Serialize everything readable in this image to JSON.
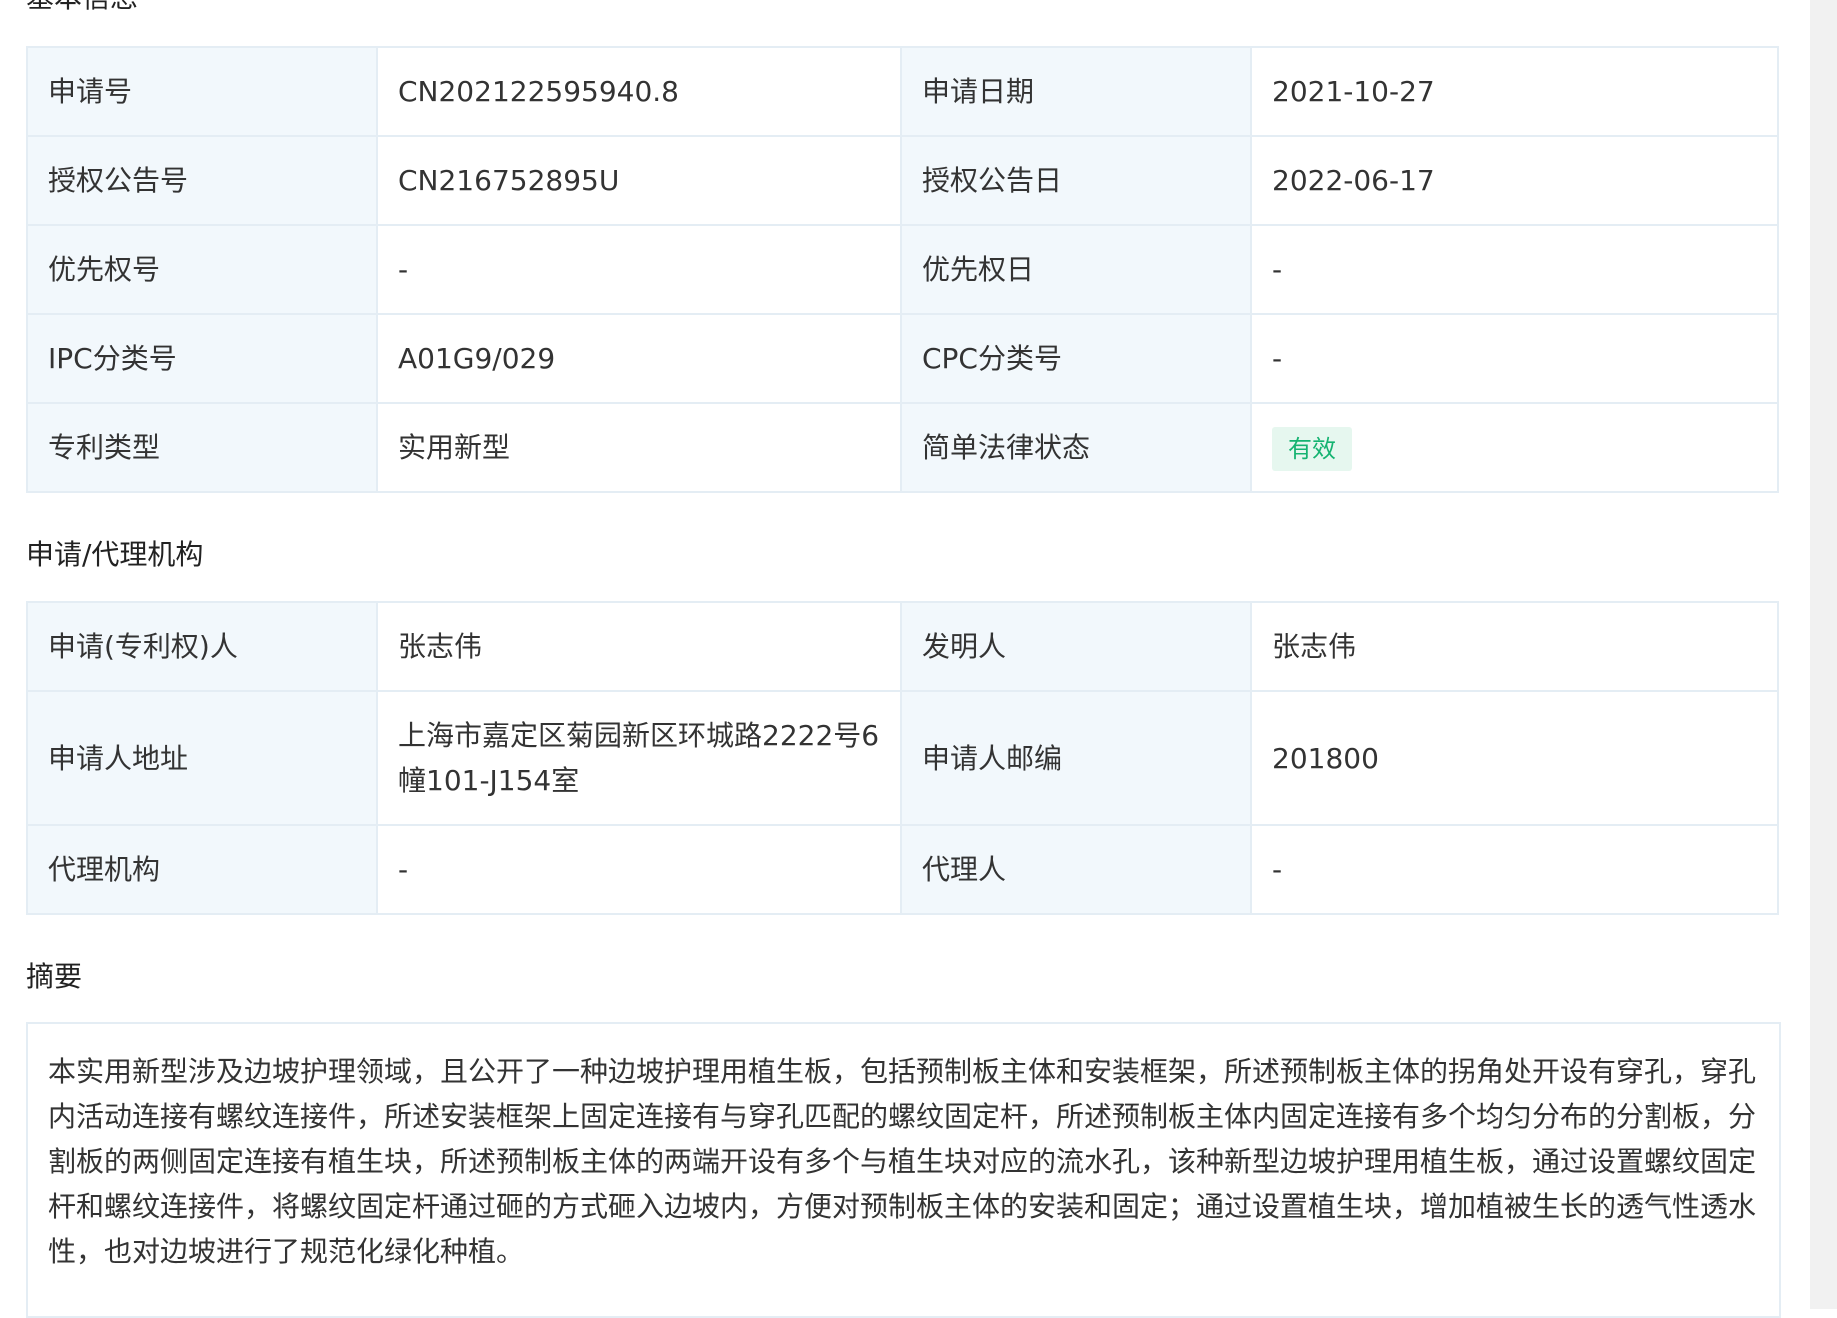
{
  "sections": {
    "basic_info": "基本信息",
    "agency": "申请/代理机构",
    "abstract": "摘要"
  },
  "basic": {
    "app_no_label": "申请号",
    "app_no": "CN202122595940.8",
    "app_date_label": "申请日期",
    "app_date": "2021-10-27",
    "grant_no_label": "授权公告号",
    "grant_no": "CN216752895U",
    "grant_date_label": "授权公告日",
    "grant_date": "2022-06-17",
    "priority_no_label": "优先权号",
    "priority_no": "-",
    "priority_date_label": "优先权日",
    "priority_date": "-",
    "ipc_label": "IPC分类号",
    "ipc": "A01G9/029",
    "cpc_label": "CPC分类号",
    "cpc": "-",
    "type_label": "专利类型",
    "type": "实用新型",
    "legal_status_label": "简单法律状态",
    "legal_status": "有效"
  },
  "agency": {
    "applicant_label": "申请(专利权)人",
    "applicant": "张志伟",
    "inventor_label": "发明人",
    "inventor": "张志伟",
    "address_label": "申请人地址",
    "address": "上海市嘉定区菊园新区环城路2222号6幢101-J154室",
    "postcode_label": "申请人邮编",
    "postcode": "201800",
    "agency_label": "代理机构",
    "agency": "-",
    "agent_label": "代理人",
    "agent": "-"
  },
  "abstract_text": "本实用新型涉及边坡护理领域，且公开了一种边坡护理用植生板，包括预制板主体和安装框架，所述预制板主体的拐角处开设有穿孔，穿孔内活动连接有螺纹连接件，所述安装框架上固定连接有与穿孔匹配的螺纹固定杆，所述预制板主体内固定连接有多个均匀分布的分割板，分割板的两侧固定连接有植生块，所述预制板主体的两端开设有多个与植生块对应的流水孔，该种新型边坡护理用植生板，通过设置螺纹固定杆和螺纹连接件，将螺纹固定杆通过砸的方式砸入边坡内，方便对预制板主体的安装和固定；通过设置植生块，增加植被生长的透气性透水性，也对边坡进行了规范化绿化种植。",
  "colors": {
    "label_bg": "#f2f8fc",
    "border": "#e4edf4",
    "status_green": "#15b371",
    "status_bg": "#e6f7ef"
  }
}
